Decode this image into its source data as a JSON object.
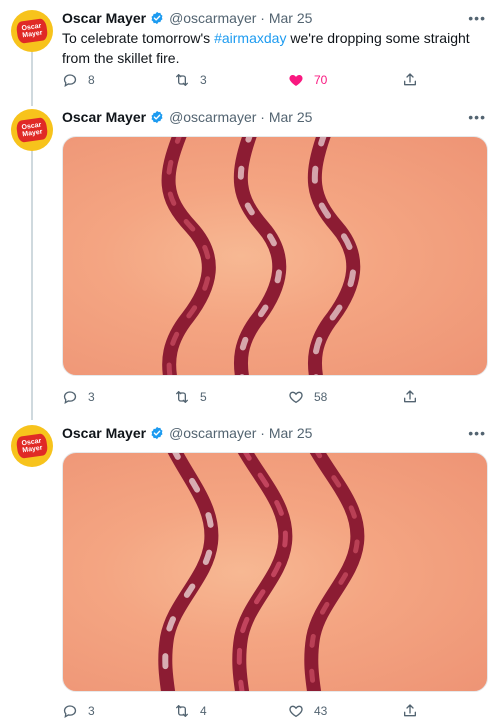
{
  "tweets": [
    {
      "name": "Oscar Mayer",
      "handle": "@oscarmayer",
      "date": "· Mar 25",
      "text_before": "To celebrate tomorrow's ",
      "hashtag": "#airmaxday",
      "text_after": " we're dropping some straight from the skillet fire.",
      "replies": "8",
      "retweets": "3",
      "likes": "70",
      "liked": true
    },
    {
      "name": "Oscar Mayer",
      "handle": "@oscarmayer",
      "date": "· Mar 25",
      "replies": "3",
      "retweets": "5",
      "likes": "58",
      "liked": false
    },
    {
      "name": "Oscar Mayer",
      "handle": "@oscarmayer",
      "date": "· Mar 25",
      "replies": "3",
      "retweets": "4",
      "likes": "43",
      "liked": false
    }
  ],
  "logo": {
    "line1": "Oscar",
    "line2": "Mayer"
  },
  "more_glyph": "•••",
  "icons": [
    "verified-badge-icon",
    "reply-icon",
    "retweet-icon",
    "like-icon",
    "share-icon",
    "more-icon"
  ],
  "colors": {
    "accent": "#1d9bf0",
    "like": "#f91880",
    "avatar_bg": "#f7c31c",
    "logo_red": "#e02a26",
    "media_bg": "#f4a582",
    "bacon": "#8c1c33"
  }
}
